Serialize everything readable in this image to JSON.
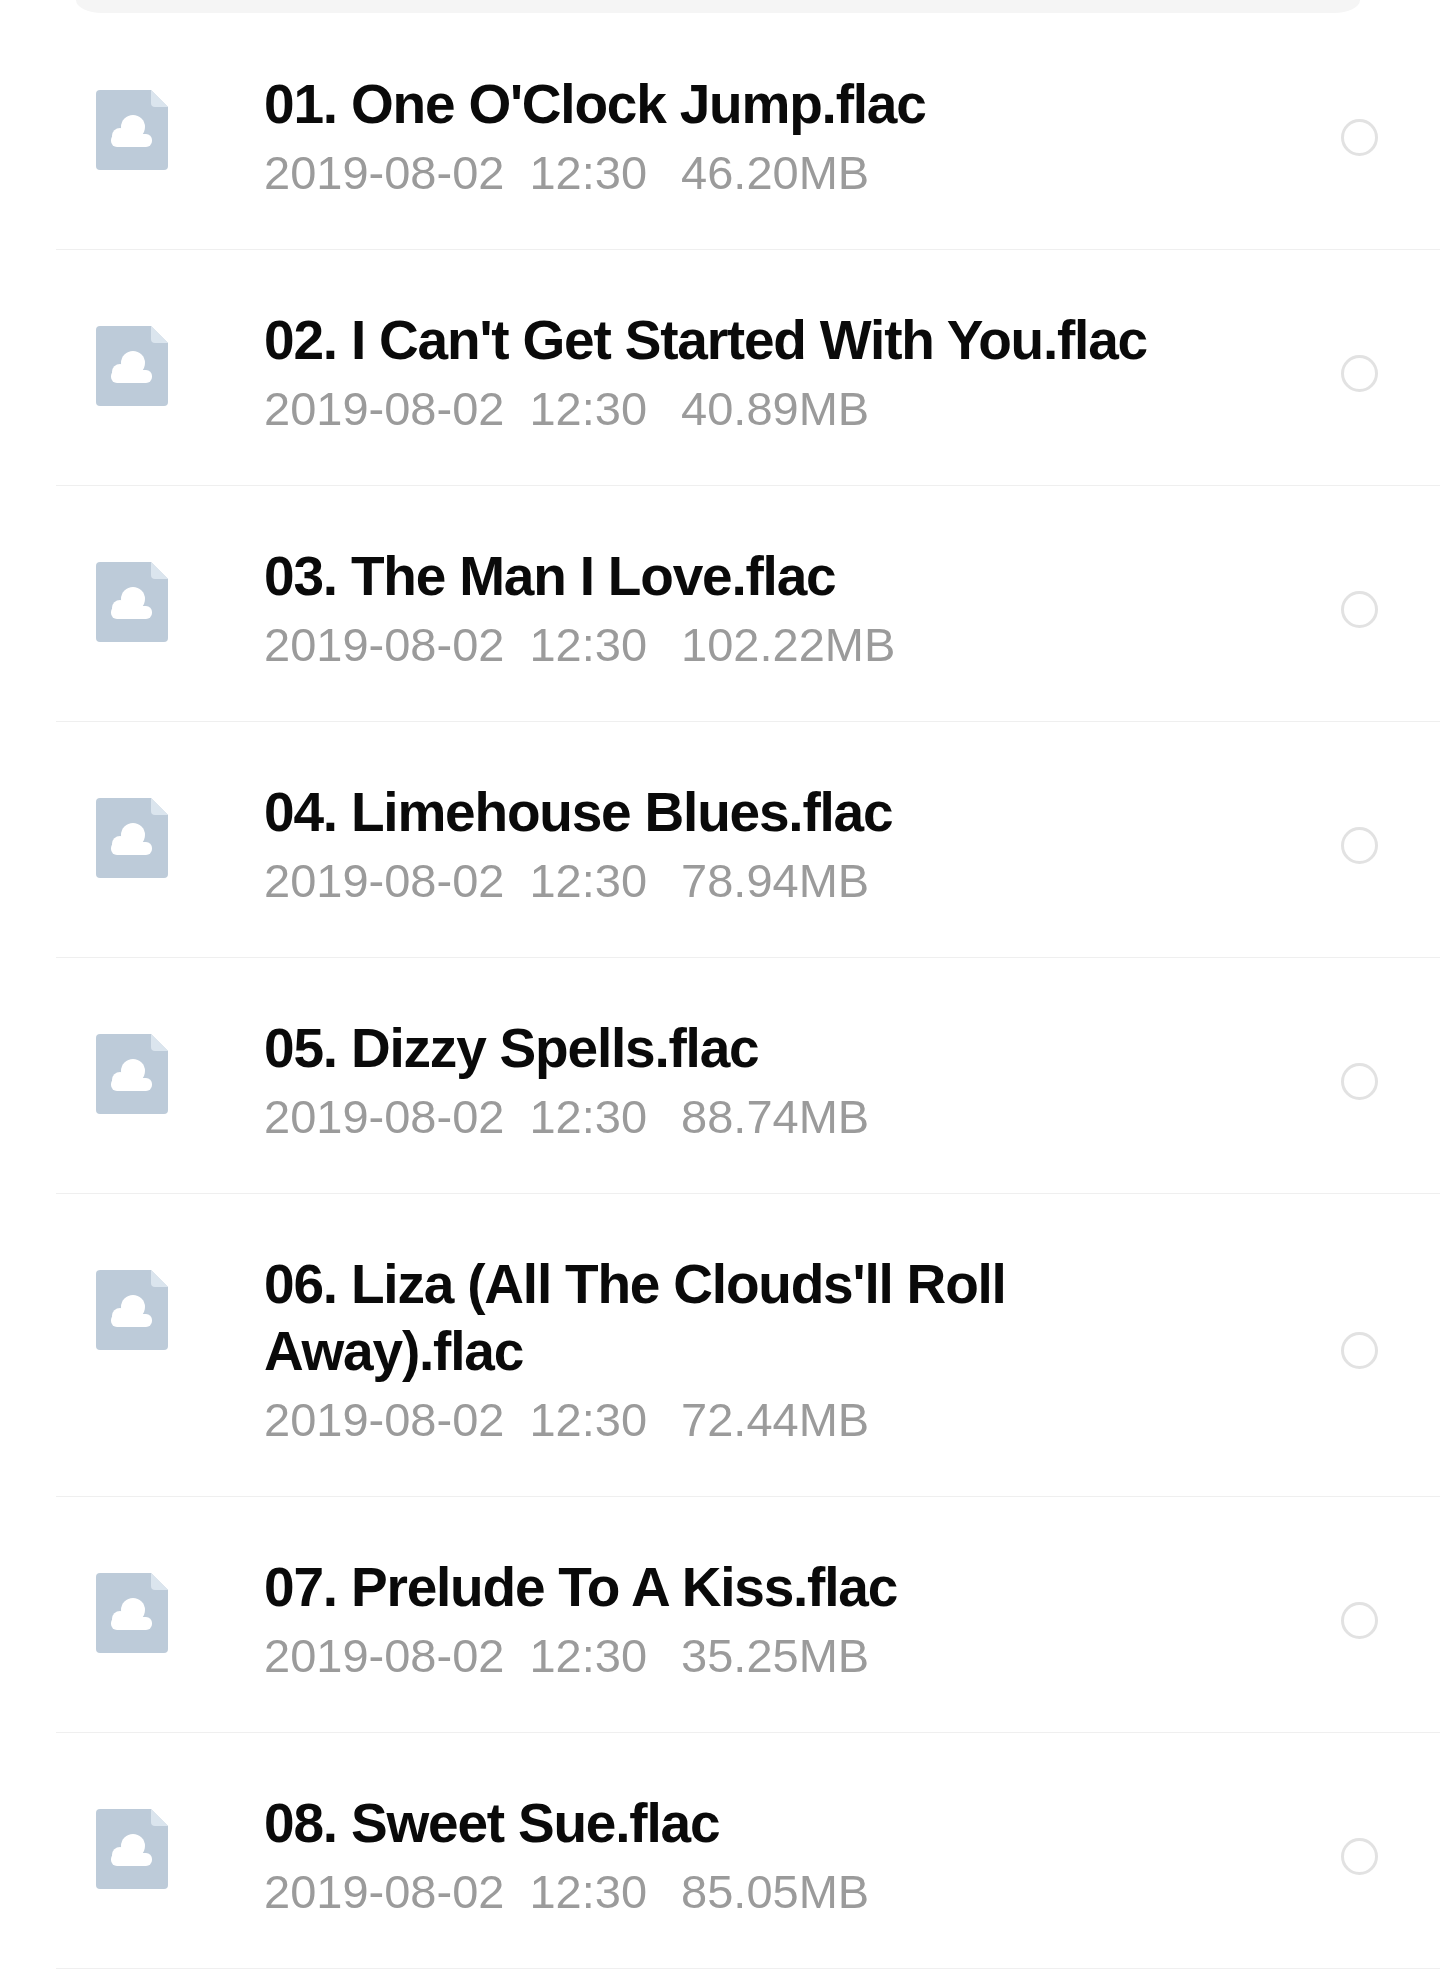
{
  "files": [
    {
      "name": "01. One O'Clock Jump.flac",
      "date": "2019-08-02",
      "time": "12:30",
      "size": "46.20MB",
      "selected": false
    },
    {
      "name": "02. I Can't Get Started With You.flac",
      "date": "2019-08-02",
      "time": "12:30",
      "size": "40.89MB",
      "selected": false
    },
    {
      "name": "03. The Man I Love.flac",
      "date": "2019-08-02",
      "time": "12:30",
      "size": "102.22MB",
      "selected": false
    },
    {
      "name": "04. Limehouse Blues.flac",
      "date": "2019-08-02",
      "time": "12:30",
      "size": "78.94MB",
      "selected": false
    },
    {
      "name": "05. Dizzy Spells.flac",
      "date": "2019-08-02",
      "time": "12:30",
      "size": "88.74MB",
      "selected": false
    },
    {
      "name": "06. Liza (All The Clouds'll Roll Away).flac",
      "date": "2019-08-02",
      "time": "12:30",
      "size": "72.44MB",
      "selected": false
    },
    {
      "name": "07. Prelude To A Kiss.flac",
      "date": "2019-08-02",
      "time": "12:30",
      "size": "35.25MB",
      "selected": false
    },
    {
      "name": "08. Sweet Sue.flac",
      "date": "2019-08-02",
      "time": "12:30",
      "size": "85.05MB",
      "selected": false
    }
  ]
}
